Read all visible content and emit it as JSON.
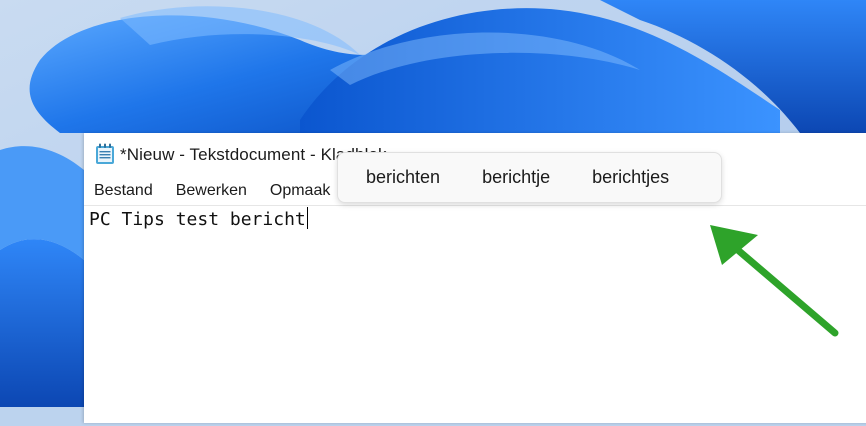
{
  "window": {
    "title": "*Nieuw - Tekstdocument - Kladblok"
  },
  "menu": {
    "items": [
      {
        "label": "Bestand"
      },
      {
        "label": "Bewerken"
      },
      {
        "label": "Opmaak"
      }
    ]
  },
  "editor": {
    "text": "PC Tips test bericht"
  },
  "suggestions": {
    "items": [
      {
        "label": "berichten"
      },
      {
        "label": "berichtje"
      },
      {
        "label": "berichtjes"
      }
    ]
  },
  "colors": {
    "arrow": "#2ea32a",
    "wallpaper_blue": "#1a6fe0"
  },
  "icons": {
    "app": "notepad-icon",
    "annotation": "green-arrow-icon"
  }
}
